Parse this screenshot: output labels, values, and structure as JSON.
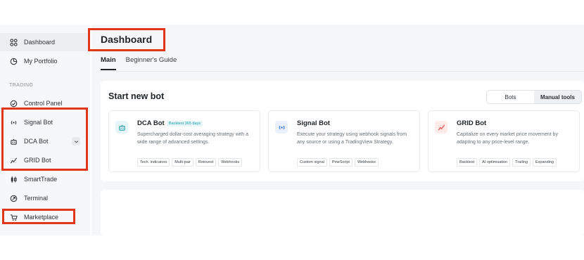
{
  "sidebar": {
    "items": [
      {
        "label": "Dashboard",
        "icon": "dashboard-grid-icon"
      },
      {
        "label": "My Portfolio",
        "icon": "pie-chart-icon"
      },
      {
        "label": "Control Panel",
        "icon": "check-circle-icon"
      },
      {
        "label": "Signal Bot",
        "icon": "broadcast-icon"
      },
      {
        "label": "DCA Bot",
        "icon": "robot-icon"
      },
      {
        "label": "GRID Bot",
        "icon": "grid-chart-icon"
      },
      {
        "label": "SmartTrade",
        "icon": "candles-icon"
      },
      {
        "label": "Terminal",
        "icon": "terminal-icon"
      },
      {
        "label": "Marketplace",
        "icon": "cart-icon"
      }
    ],
    "section_label": "TRADING"
  },
  "header": {
    "title": "Dashboard"
  },
  "tabs": [
    {
      "label": "Main",
      "active": true
    },
    {
      "label": "Beginner's Guide",
      "active": false
    }
  ],
  "start_bot": {
    "title": "Start new bot",
    "toggle": {
      "options": [
        "Bots",
        "Manual tools"
      ],
      "selected": "Manual tools"
    },
    "cards": [
      {
        "title": "DCA Bot",
        "badge": "Backtest 365 days",
        "icon": "robot-icon",
        "description": "Supercharged dollar-cost averaging strategy with a wide range of advanced settings.",
        "tags": [
          "Tech. indicators",
          "Multi-pair",
          "Reinvest",
          "Webhooks"
        ]
      },
      {
        "title": "Signal Bot",
        "icon": "broadcast-icon",
        "description": "Execute your strategy using webhook signals from any source or using a TradingView Strategy.",
        "tags": [
          "Custom signal",
          "PineScript",
          "Webhooks"
        ]
      },
      {
        "title": "GRID Bot",
        "icon": "grid-chart-icon",
        "description": "Capitalize on every market price movement by adapting to any price-level range.",
        "tags": [
          "Backtest",
          "AI optimisation",
          "Trailing",
          "Expanding"
        ]
      }
    ]
  },
  "colors": {
    "accent_highlight": "#e0371b",
    "teal": "#1e9aa8",
    "grid_red": "#d8453a",
    "signal_blue": "#2f6fd6"
  }
}
